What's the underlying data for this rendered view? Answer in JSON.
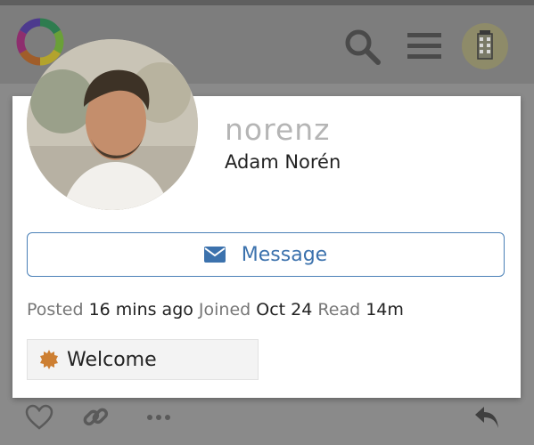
{
  "header": {
    "logo_icon": "ring-logo-icon",
    "search_icon": "search-icon",
    "menu_icon": "hamburger-menu-icon",
    "user_avatar_icon": "user-avatar"
  },
  "card": {
    "username": "norenz",
    "full_name": "Adam Norén",
    "message_button": {
      "icon": "envelope-icon",
      "label": "Message"
    },
    "stats": {
      "posted_label": "Posted",
      "posted_value": "16 mins ago",
      "joined_label": "Joined",
      "joined_value": "Oct 24",
      "read_label": "Read",
      "read_value": "14m"
    },
    "badge": {
      "icon": "badge-icon",
      "label": "Welcome"
    }
  },
  "post_actions": {
    "like_icon": "heart-icon",
    "link_icon": "link-icon",
    "more_icon": "more-icon",
    "reply_icon": "reply-icon"
  },
  "colors": {
    "accent": "#3c72ad",
    "overlay": "#8a8a8a",
    "badge_bronze": "#cd7f32"
  }
}
